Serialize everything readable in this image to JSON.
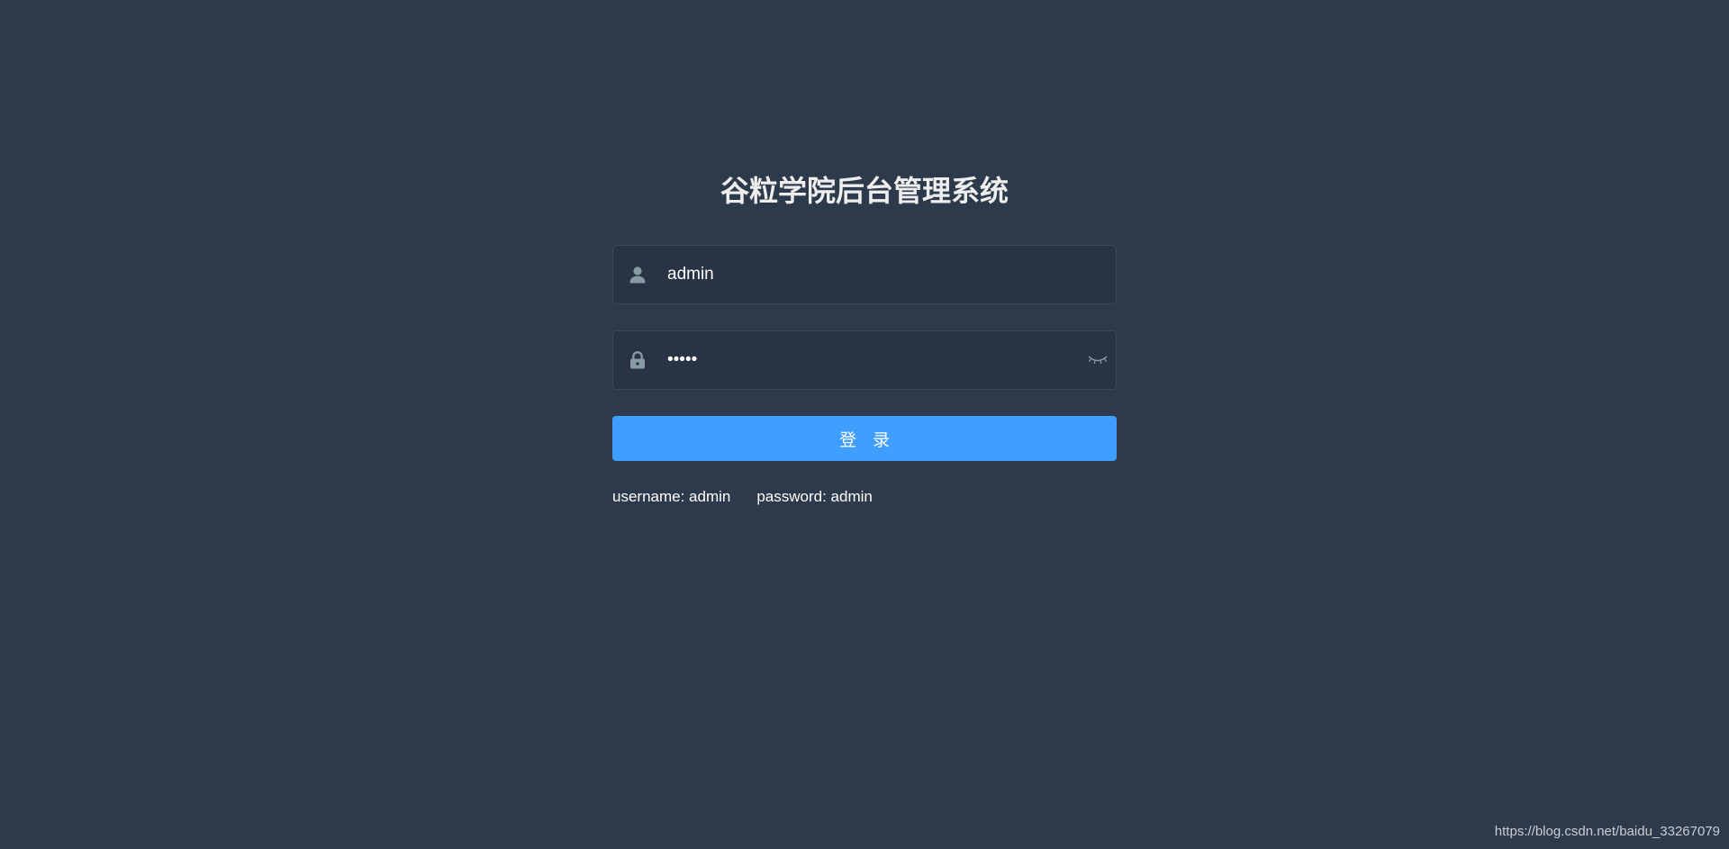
{
  "login": {
    "title": "谷粒学院后台管理系统",
    "username_field": {
      "value": "admin",
      "icon": "user-icon"
    },
    "password_field": {
      "value": "admin",
      "icon": "lock-icon",
      "toggle_icon": "eye-closed-icon"
    },
    "login_button_label": "登 录",
    "tips": {
      "username": "username: admin",
      "password": "password: admin"
    }
  },
  "watermark": "https://blog.csdn.net/baidu_33267079",
  "colors": {
    "background": "#2d3a4b",
    "input_background": "#283443",
    "primary": "#409eff",
    "icon": "#889aa4"
  }
}
